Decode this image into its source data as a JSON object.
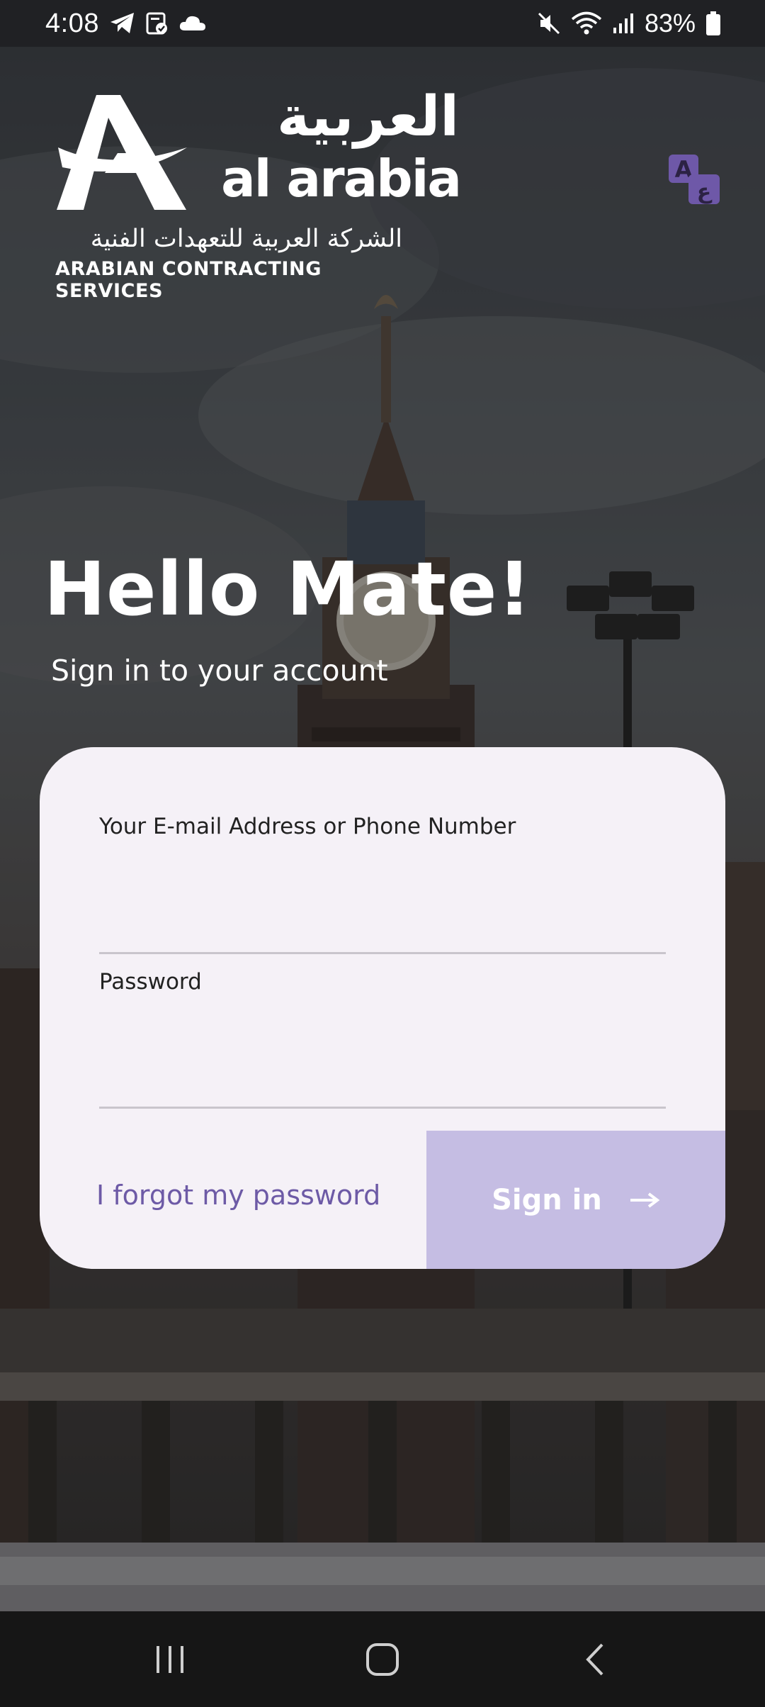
{
  "status_bar": {
    "time": "4:08",
    "battery": "83%",
    "icons_left": [
      "telegram-icon",
      "tasks-icon",
      "cloud-icon"
    ],
    "icons_right": [
      "mute-icon",
      "wifi-icon",
      "signal-icon",
      "battery-icon"
    ]
  },
  "logo": {
    "arabic_title": "العربية",
    "latin_name": "al arabia",
    "arabic_subtitle": "الشركة العربية للتعهدات الفنية",
    "english_subtitle": "ARABIAN CONTRACTING SERVICES"
  },
  "language_button": {
    "icon": "translate-icon",
    "color": "#6e58a8"
  },
  "hero": {
    "greeting": "Hello Mate!",
    "subtitle": "Sign in to your account"
  },
  "form": {
    "email_label": "Your E-mail Address or Phone Number",
    "email_value": "",
    "password_label": "Password",
    "password_value": "",
    "forgot_link": "I forgot my password",
    "signin_label": "Sign in",
    "signin_icon": "arrow-right-icon"
  },
  "colors": {
    "accent": "#6d5aa6",
    "button_bg": "#c5bde3",
    "card_bg": "#f5f1f7"
  },
  "nav_bar": {
    "items": [
      "recent-apps-icon",
      "home-icon",
      "back-icon"
    ]
  }
}
